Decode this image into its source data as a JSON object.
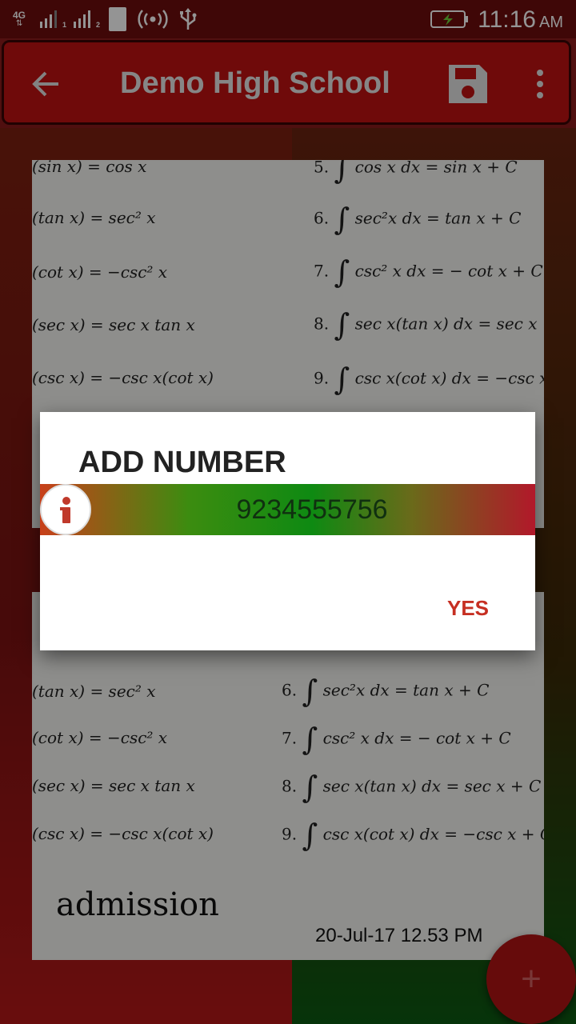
{
  "status_bar": {
    "network": "4G",
    "sim1": "1",
    "sim2": "2",
    "time": "11:16",
    "ampm": "AM"
  },
  "app_bar": {
    "title": "Demo High School",
    "back_icon": "arrow-back-icon",
    "save_icon": "save-icon",
    "menu_icon": "more-vert-icon"
  },
  "cards": [
    {
      "left_formulas": [
        "(sin x) = cos x",
        "(tan x) = sec² x",
        "(cot x) = −csc² x",
        "(sec x) = sec x  tan x",
        "(csc x) = −csc x(cot x)"
      ],
      "right_formulas": [
        {
          "num": "5.",
          "text": "cos x dx = sin x + C"
        },
        {
          "num": "6.",
          "text": "sec²x dx = tan x + C"
        },
        {
          "num": "7.",
          "text": "csc² x dx = − cot x + C"
        },
        {
          "num": "8.",
          "text": "sec x(tan x) dx = sec x +"
        },
        {
          "num": "9.",
          "text": "csc x(cot x) dx = −csc x"
        }
      ]
    },
    {
      "left_formulas": [
        "(tan x) = sec² x",
        "(cot x) = −csc² x",
        "(sec x) = sec x  tan x",
        "(csc x) = −csc x(cot x)"
      ],
      "right_formulas": [
        {
          "num": "6.",
          "text": "sec²x dx = tan x + C"
        },
        {
          "num": "7.",
          "text": "csc² x dx = − cot x + C"
        },
        {
          "num": "8.",
          "text": "sec x(tan x) dx = sec x + C"
        },
        {
          "num": "9.",
          "text": "csc x(cot x) dx = −csc x + C"
        }
      ],
      "caption": "admission",
      "timestamp": "20-Jul-17 12.53 PM"
    }
  ],
  "fab": {
    "icon": "plus-icon",
    "label": "+"
  },
  "dialog": {
    "title": "ADD NUMBER",
    "number": "9234555756",
    "info_icon": "info-icon",
    "yes_label": "YES"
  },
  "colors": {
    "app_bar": "#c01212",
    "status_bar": "#6d0d0d",
    "yes_text": "#c62f22"
  }
}
